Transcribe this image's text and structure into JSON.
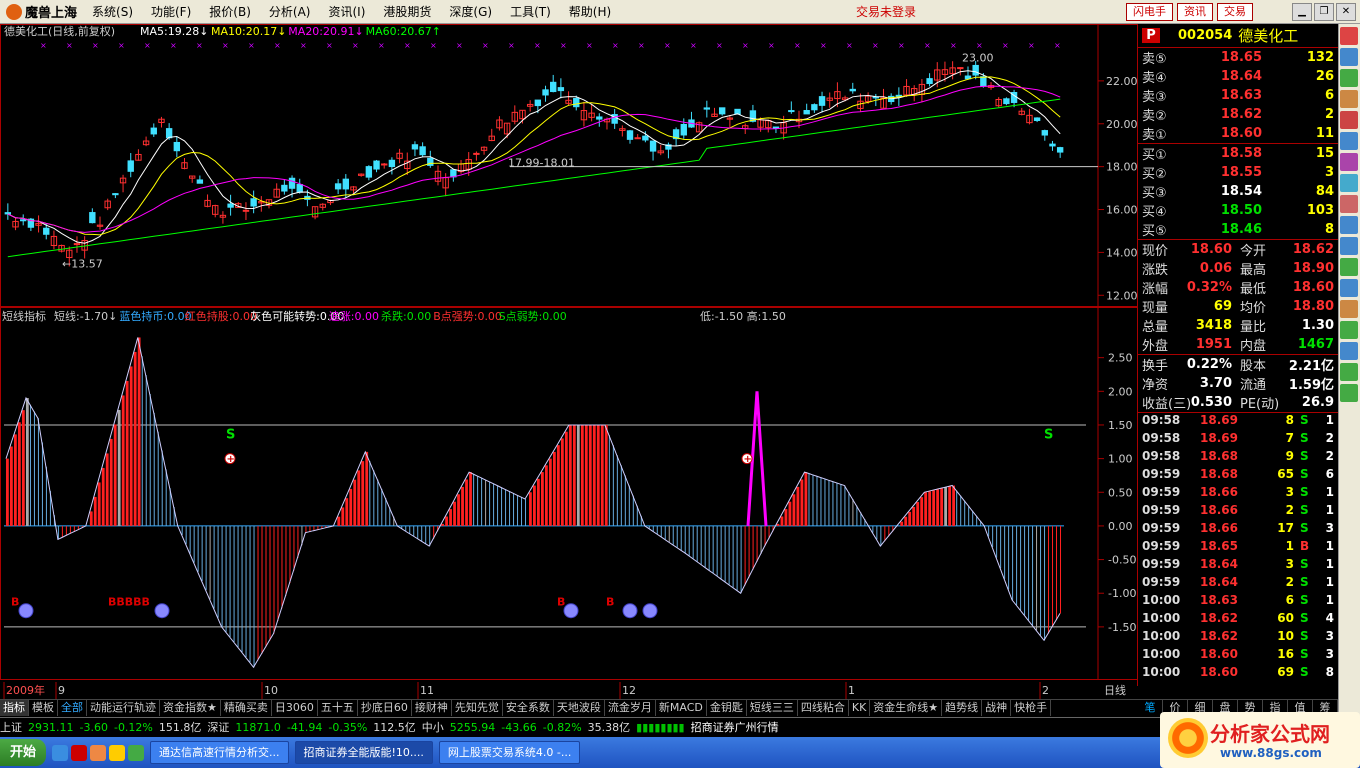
{
  "menubar": {
    "app_name": "魔兽上海",
    "items": [
      "系统(S)",
      "功能(F)",
      "报价(B)",
      "分析(A)",
      "资讯(I)",
      "港股期货",
      "深度(G)",
      "工具(T)",
      "帮助(H)"
    ],
    "notice": "交易未登录",
    "buttons": [
      "闪电手",
      "资讯",
      "交易"
    ]
  },
  "chart": {
    "title": "德美化工(日线,前复权)",
    "ma_labels": [
      {
        "text": "MA5:19.28↓",
        "color": "#ffffff"
      },
      {
        "text": "MA10:20.17↓",
        "color": "#ffff00"
      },
      {
        "text": "MA20:20.91↓",
        "color": "#ff00ff"
      },
      {
        "text": "MA60:20.67↑",
        "color": "#00ff00"
      }
    ],
    "price_axis": [
      "22.00",
      "20.00",
      "18.00",
      "16.00",
      "14.00",
      "12.00"
    ],
    "annotations": {
      "high": "23.00",
      "low": "←13.57",
      "level": "17.99-18.01"
    },
    "indicator_title": "短线指标",
    "indicator_labels": [
      {
        "text": "短线:-1.70↓",
        "color": "#cccccc"
      },
      {
        "text": "蓝色持币:0.00",
        "color": "#33aaff"
      },
      {
        "text": "红色持股:0.00",
        "color": "#ff3030"
      },
      {
        "text": "灰色可能转势:0.00",
        "color": "#ffffff"
      },
      {
        "text": "追涨:0.00",
        "color": "#ff00ff"
      },
      {
        "text": "杀跌:0.00",
        "color": "#00e000"
      },
      {
        "text": "B点强势:0.00",
        "color": "#ff3030"
      },
      {
        "text": "S点弱势:0.00",
        "color": "#00e000"
      },
      {
        "text": "低:-1.50 高:1.50",
        "color": "#cccccc"
      }
    ],
    "indicator_axis": [
      "2.50",
      "2.00",
      "1.50",
      "1.00",
      "0.50",
      "0.00",
      "-0.50",
      "-1.00",
      "-1.50"
    ],
    "signal_s": "S",
    "signal_b": "B",
    "date_labels": [
      "2009年",
      "9",
      "10",
      "11",
      "12",
      "1",
      "2"
    ],
    "period": "日线",
    "markers_bbb": "BBBBB"
  },
  "chart_data": {
    "type": "candlestick",
    "title": "德美化工(日线,前复权)",
    "ylim": [
      11.5,
      24
    ],
    "ma": {
      "MA5": 19.28,
      "MA10": 20.17,
      "MA20": 20.91,
      "MA60": 20.67
    },
    "indicator_ylim": [
      -2.2,
      3.0
    ],
    "indicator_lines": [
      1.5,
      -1.5
    ]
  },
  "tabs": [
    "指标",
    "模板",
    "全部",
    "动能运行轨迹",
    "资金指数★",
    "精确买卖",
    "日3060",
    "五十五",
    "抄底日60",
    "接财神",
    "先知先觉",
    "安全系数",
    "天地波段",
    "流金岁月",
    "新MACD",
    "金钥匙",
    "短线三三",
    "四线粘合",
    "KK",
    "资金生命线★",
    "趋势线",
    "战神",
    "快枪手"
  ],
  "quote": {
    "code": "002054",
    "name": "德美化工",
    "asks": [
      {
        "label": "卖⑤",
        "price": "18.65",
        "vol": "132"
      },
      {
        "label": "卖④",
        "price": "18.64",
        "vol": "26"
      },
      {
        "label": "卖③",
        "price": "18.63",
        "vol": "6"
      },
      {
        "label": "卖②",
        "price": "18.62",
        "vol": "2"
      },
      {
        "label": "卖①",
        "price": "18.60",
        "vol": "11"
      }
    ],
    "bids": [
      {
        "label": "买①",
        "price": "18.58",
        "vol": "15"
      },
      {
        "label": "买②",
        "price": "18.55",
        "vol": "3"
      },
      {
        "label": "买③",
        "price": "18.54",
        "vol": "84"
      },
      {
        "label": "买④",
        "price": "18.50",
        "vol": "103"
      },
      {
        "label": "买⑤",
        "price": "18.46",
        "vol": "8"
      }
    ],
    "stats1": [
      {
        "l": "现价",
        "v": "18.60",
        "l2": "今开",
        "v2": "18.62"
      },
      {
        "l": "涨跌",
        "v": "0.06",
        "l2": "最高",
        "v2": "18.90"
      },
      {
        "l": "涨幅",
        "v": "0.32%",
        "l2": "最低",
        "v2": "18.60"
      },
      {
        "l": "现量",
        "v": "69",
        "l2": "均价",
        "v2": "18.80"
      },
      {
        "l": "总量",
        "v": "3418",
        "l2": "量比",
        "v2": "1.30"
      },
      {
        "l": "外盘",
        "v": "1951",
        "l2": "内盘",
        "v2": "1467"
      }
    ],
    "stats2": [
      {
        "l": "换手",
        "v": "0.22%",
        "l2": "股本",
        "v2": "2.21亿"
      },
      {
        "l": "净资",
        "v": "3.70",
        "l2": "流通",
        "v2": "1.59亿"
      },
      {
        "l": "收益(三)",
        "v": "0.530",
        "l2": "PE(动)",
        "v2": "26.9"
      }
    ],
    "ticks": [
      {
        "t": "09:58",
        "p": "18.69",
        "v": "8",
        "d": "S",
        "n": "1"
      },
      {
        "t": "09:58",
        "p": "18.69",
        "v": "7",
        "d": "S",
        "n": "2"
      },
      {
        "t": "09:58",
        "p": "18.68",
        "v": "9",
        "d": "S",
        "n": "2"
      },
      {
        "t": "09:59",
        "p": "18.68",
        "v": "65",
        "d": "S",
        "n": "6"
      },
      {
        "t": "09:59",
        "p": "18.66",
        "v": "3",
        "d": "S",
        "n": "1"
      },
      {
        "t": "09:59",
        "p": "18.66",
        "v": "2",
        "d": "S",
        "n": "1"
      },
      {
        "t": "09:59",
        "p": "18.66",
        "v": "17",
        "d": "S",
        "n": "3"
      },
      {
        "t": "09:59",
        "p": "18.65",
        "v": "1",
        "d": "B",
        "n": "1"
      },
      {
        "t": "09:59",
        "p": "18.64",
        "v": "3",
        "d": "S",
        "n": "1"
      },
      {
        "t": "09:59",
        "p": "18.64",
        "v": "2",
        "d": "S",
        "n": "1"
      },
      {
        "t": "10:00",
        "p": "18.63",
        "v": "6",
        "d": "S",
        "n": "1"
      },
      {
        "t": "10:00",
        "p": "18.62",
        "v": "60",
        "d": "S",
        "n": "4"
      },
      {
        "t": "10:00",
        "p": "18.62",
        "v": "10",
        "d": "S",
        "n": "3"
      },
      {
        "t": "10:00",
        "p": "18.60",
        "v": "16",
        "d": "S",
        "n": "3"
      },
      {
        "t": "10:00",
        "p": "18.60",
        "v": "69",
        "d": "S",
        "n": "8"
      }
    ],
    "tabs": [
      "笔",
      "价",
      "细",
      "盘",
      "势",
      "指",
      "值",
      "筹"
    ]
  },
  "status": [
    {
      "name": "上证",
      "val": "2931.11",
      "chg": "-3.60",
      "pct": "-0.12%",
      "amt": "151.8亿"
    },
    {
      "name": "深证",
      "val": "11871.0",
      "chg": "-41.94",
      "pct": "-0.35%",
      "amt": "112.5亿"
    },
    {
      "name": "中小",
      "val": "5255.94",
      "chg": "-43.66",
      "pct": "-0.82%",
      "amt": "35.38亿"
    }
  ],
  "status_broker": "招商证券广州行情",
  "taskbar": {
    "start": "开始",
    "items": [
      "通达信高速行情分析交...",
      "招商证券全能版能!10....",
      "网上股票交易系统4.0 -..."
    ]
  },
  "watermark": {
    "title": "分析家公式网",
    "url": "www.88gs.com"
  }
}
